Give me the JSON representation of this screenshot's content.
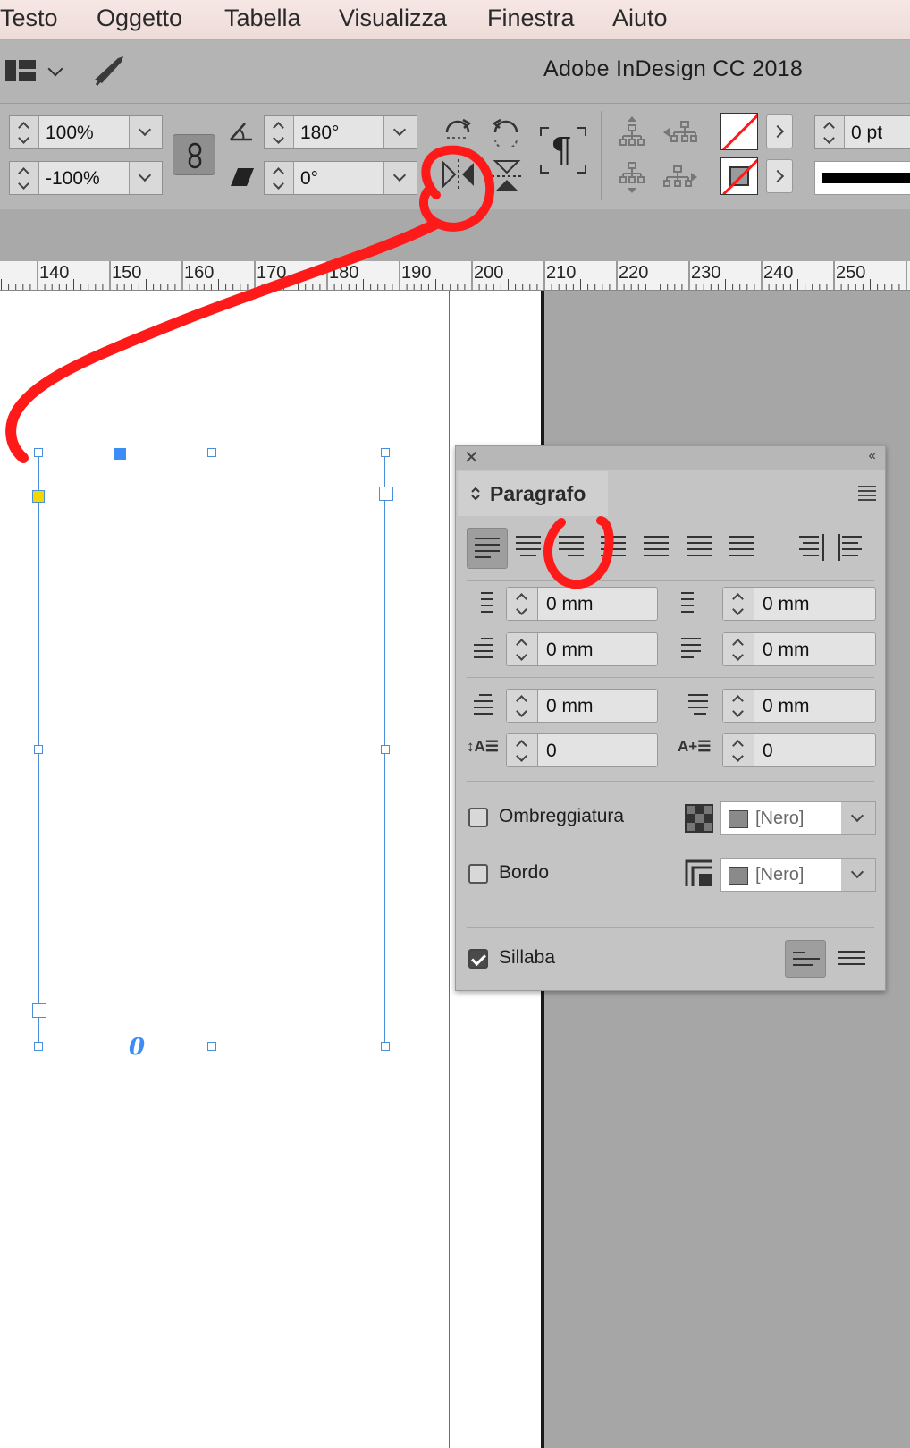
{
  "menubar": {
    "items": [
      "Testo",
      "Oggetto",
      "Tabella",
      "Visualizza",
      "Finestra",
      "Aiuto"
    ]
  },
  "titlebar": {
    "app_title": "Adobe InDesign CC 2018"
  },
  "controlbar": {
    "scale_x": "100%",
    "scale_y": "-100%",
    "rotation": "180°",
    "shear": "0°",
    "stroke_weight": "0 pt",
    "paragraph_symbol": "¶"
  },
  "ruler": {
    "labels": [
      "140",
      "150",
      "160",
      "170",
      "180",
      "190",
      "200",
      "210",
      "220",
      "230",
      "240",
      "250"
    ]
  },
  "frame": {
    "overflow_marker": "0"
  },
  "panel": {
    "title": "Paragrafo",
    "left_indent": "0 mm",
    "right_indent": "0 mm",
    "first_line_indent": "0 mm",
    "last_line_indent": "0 mm",
    "space_before": "0 mm",
    "space_after": "0 mm",
    "dropcap_lines": "0",
    "dropcap_chars": "0",
    "shading_label": "Ombreggiatura",
    "shading_swatch": "[Nero]",
    "border_label": "Bordo",
    "border_swatch": "[Nero]",
    "hyphenate_label": "Sillaba",
    "hyphenate_checked": true
  },
  "colors": {
    "annotation_red": "#ff1a1a",
    "selection_blue": "#4a8fd9",
    "margin_guide": "#b03cb0"
  }
}
